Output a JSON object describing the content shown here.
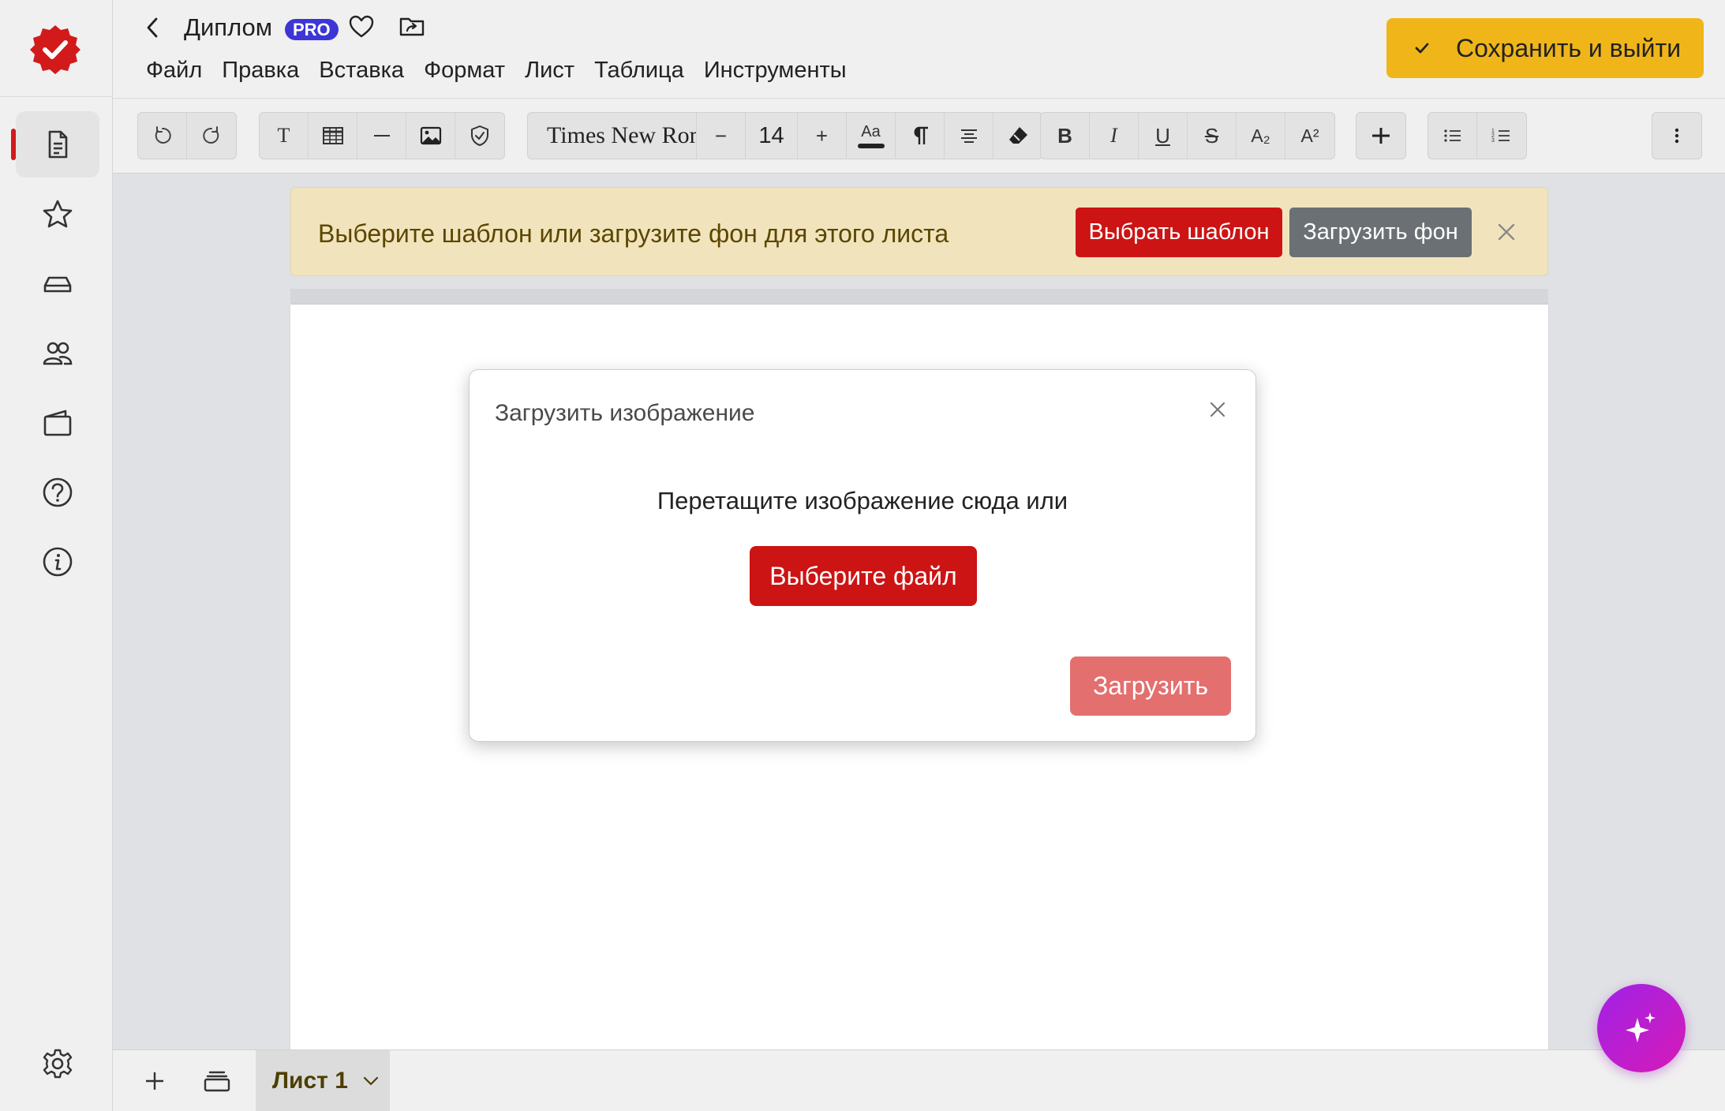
{
  "header": {
    "doc_title": "Диплом",
    "pro_badge": "PRO",
    "menu": [
      "Файл",
      "Правка",
      "Вставка",
      "Формат",
      "Лист",
      "Таблица",
      "Инструменты"
    ],
    "save_exit_label": "Сохранить и выйти"
  },
  "toolbar": {
    "font_name": "Times New Roman",
    "font_size": "14",
    "text_tool": "T",
    "case_label": "Aa",
    "bold": "B",
    "italic": "I",
    "underline": "U",
    "strike": "S",
    "subscript": "A₂",
    "superscript": "A²",
    "minus": "−",
    "plus": "+"
  },
  "banner": {
    "text": "Выберите шаблон или загрузите фон для этого листа",
    "choose_template": "Выбрать шаблон",
    "upload_background": "Загрузить фон"
  },
  "modal": {
    "title": "Загрузить изображение",
    "drop_text": "Перетащите изображение сюда или",
    "choose_file": "Выберите файл",
    "upload": "Загрузить"
  },
  "bottom": {
    "sheet_tab": "Лист 1"
  },
  "colors": {
    "brand_red": "#cc1414",
    "accent_yellow": "#f0b619",
    "pro_blue": "#3d35d6",
    "banner_bg": "#f1e4bd"
  }
}
